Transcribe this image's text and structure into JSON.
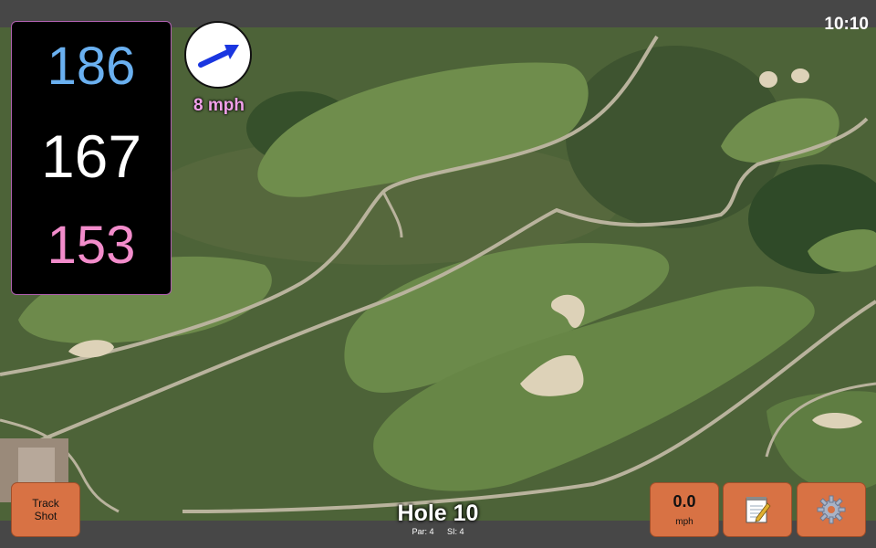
{
  "status": {
    "time": "10:10"
  },
  "yardages": {
    "back": "186",
    "middle": "167",
    "front": "153"
  },
  "wind": {
    "speed_label": "8 mph",
    "icon": "wind-direction-arrow-icon"
  },
  "buttons": {
    "track_shot": {
      "line1": "Track",
      "line2": "Shot"
    },
    "speed": {
      "value": "0.0",
      "unit": "mph"
    },
    "notes_icon": "notepad-icon",
    "settings_icon": "gear-icon"
  },
  "hole": {
    "title": "Hole 10",
    "par": "Par: 4",
    "si": "SI: 4"
  },
  "colors": {
    "back": "#6ab0f0",
    "middle": "#ffffff",
    "front": "#f28ccb",
    "button": "#d87244",
    "wind_label": "#f0a0e8"
  }
}
